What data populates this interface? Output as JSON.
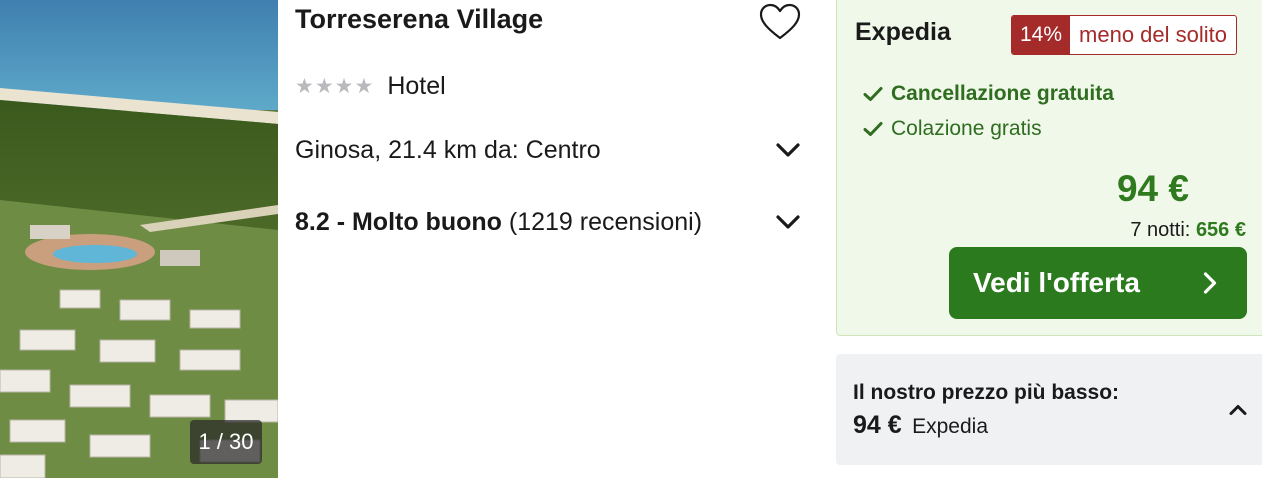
{
  "hotel": {
    "name": "Torreserena Village",
    "stars": 4,
    "type": "Hotel",
    "location": "Ginosa, 21.4 km da: Centro",
    "rating_score": "8.2 - Molto buono",
    "rating_reviews": "(1219 recensioni)",
    "photo_counter": "1 / 30",
    "favorite_icon": "heart-outline-icon"
  },
  "offer": {
    "provider": "Expedia",
    "discount_percent": "14%",
    "discount_text": "meno del solito",
    "features": [
      {
        "label": "Cancellazione gratuita",
        "icon": "check-icon"
      },
      {
        "label": "Colazione gratis",
        "icon": "check-icon"
      }
    ],
    "price": "94 €",
    "nights_label": "7 notti:",
    "nights_total": "656 €",
    "cta_label": "Vedi l'offerta",
    "cta_icon": "chevron-right-icon"
  },
  "lowest": {
    "title": "Il nostro prezzo più basso:",
    "price": "94 €",
    "provider": "Expedia",
    "icon": "chevron-up-icon"
  },
  "colors": {
    "accent_green": "#2b7a1e",
    "offer_bg": "#f0f8e9",
    "discount_red": "#a52a2a",
    "star_grey": "#b9b9be",
    "lowest_bg": "#f0f1f3"
  }
}
